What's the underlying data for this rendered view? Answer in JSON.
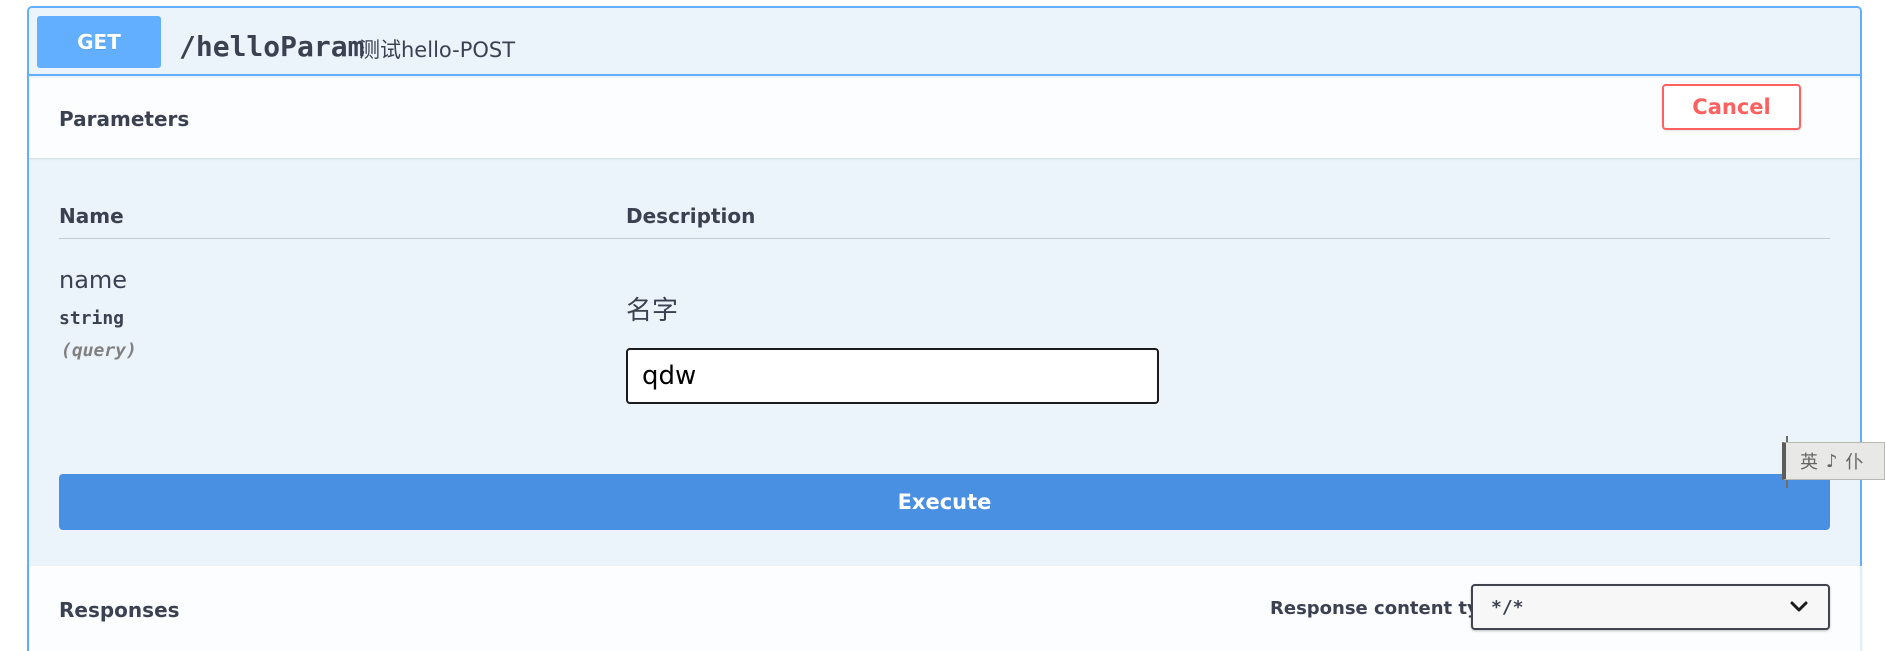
{
  "operation": {
    "method": "GET",
    "path": "/helloParam",
    "summary": "测试hello-POST"
  },
  "parameters_section": {
    "title": "Parameters",
    "cancel_label": "Cancel",
    "columns": {
      "name": "Name",
      "description": "Description"
    },
    "params": [
      {
        "name": "name",
        "type": "string",
        "in": "(query)",
        "description": "名字",
        "value": "qdw"
      }
    ],
    "execute_label": "Execute"
  },
  "responses_section": {
    "title": "Responses",
    "content_type_label": "Response content type",
    "content_type_value": "*/*"
  },
  "ime_widget": {
    "chars": [
      "英",
      "♪",
      "仆"
    ]
  },
  "colors": {
    "get_accent": "#61affe",
    "execute": "#4990e2",
    "cancel": "#ff6060"
  }
}
